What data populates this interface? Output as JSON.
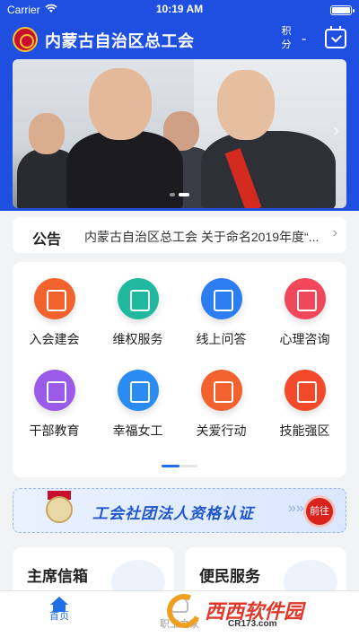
{
  "status_bar": {
    "carrier": "Carrier",
    "time": "10:19 AM"
  },
  "header": {
    "title": "内蒙古自治区总工会",
    "points_label": "积分",
    "points_value": "-",
    "logo_icon": "union-emblem-icon",
    "checkin_icon": "calendar-check-icon"
  },
  "banner": {
    "slide_count": 2,
    "active_slide": 2
  },
  "notice": {
    "tag": "公告",
    "text": "内蒙古自治区总工会 关于命名2019年度“..."
  },
  "services": [
    {
      "label": "入会建会",
      "icon": "book-icon",
      "color": "#f2622e"
    },
    {
      "label": "维权服务",
      "icon": "gavel-icon",
      "color": "#20b9a0"
    },
    {
      "label": "线上问答",
      "icon": "question-icon",
      "color": "#2b7df0"
    },
    {
      "label": "心理咨询",
      "icon": "heart-pulse-icon",
      "color": "#f0475a"
    },
    {
      "label": "干部教育",
      "icon": "pencil-ruler-icon",
      "color": "#9a5be8"
    },
    {
      "label": "幸福女工",
      "icon": "helmet-icon",
      "color": "#2a8cf2"
    },
    {
      "label": "关爱行动",
      "icon": "heart-home-icon",
      "color": "#f2622e"
    },
    {
      "label": "技能强区",
      "icon": "tools-icon",
      "color": "#f24a2a"
    }
  ],
  "certification": {
    "text": "工会社团法人资格认证",
    "button_label": "前往"
  },
  "cards": {
    "left_title": "主席信箱",
    "right_title": "便民服务"
  },
  "tabbar": {
    "items": [
      {
        "label": "首页",
        "active": true
      },
      {
        "label": "职工之家",
        "active": false
      }
    ]
  },
  "watermark": {
    "text": "西西软件园",
    "url": "CR173.com"
  }
}
